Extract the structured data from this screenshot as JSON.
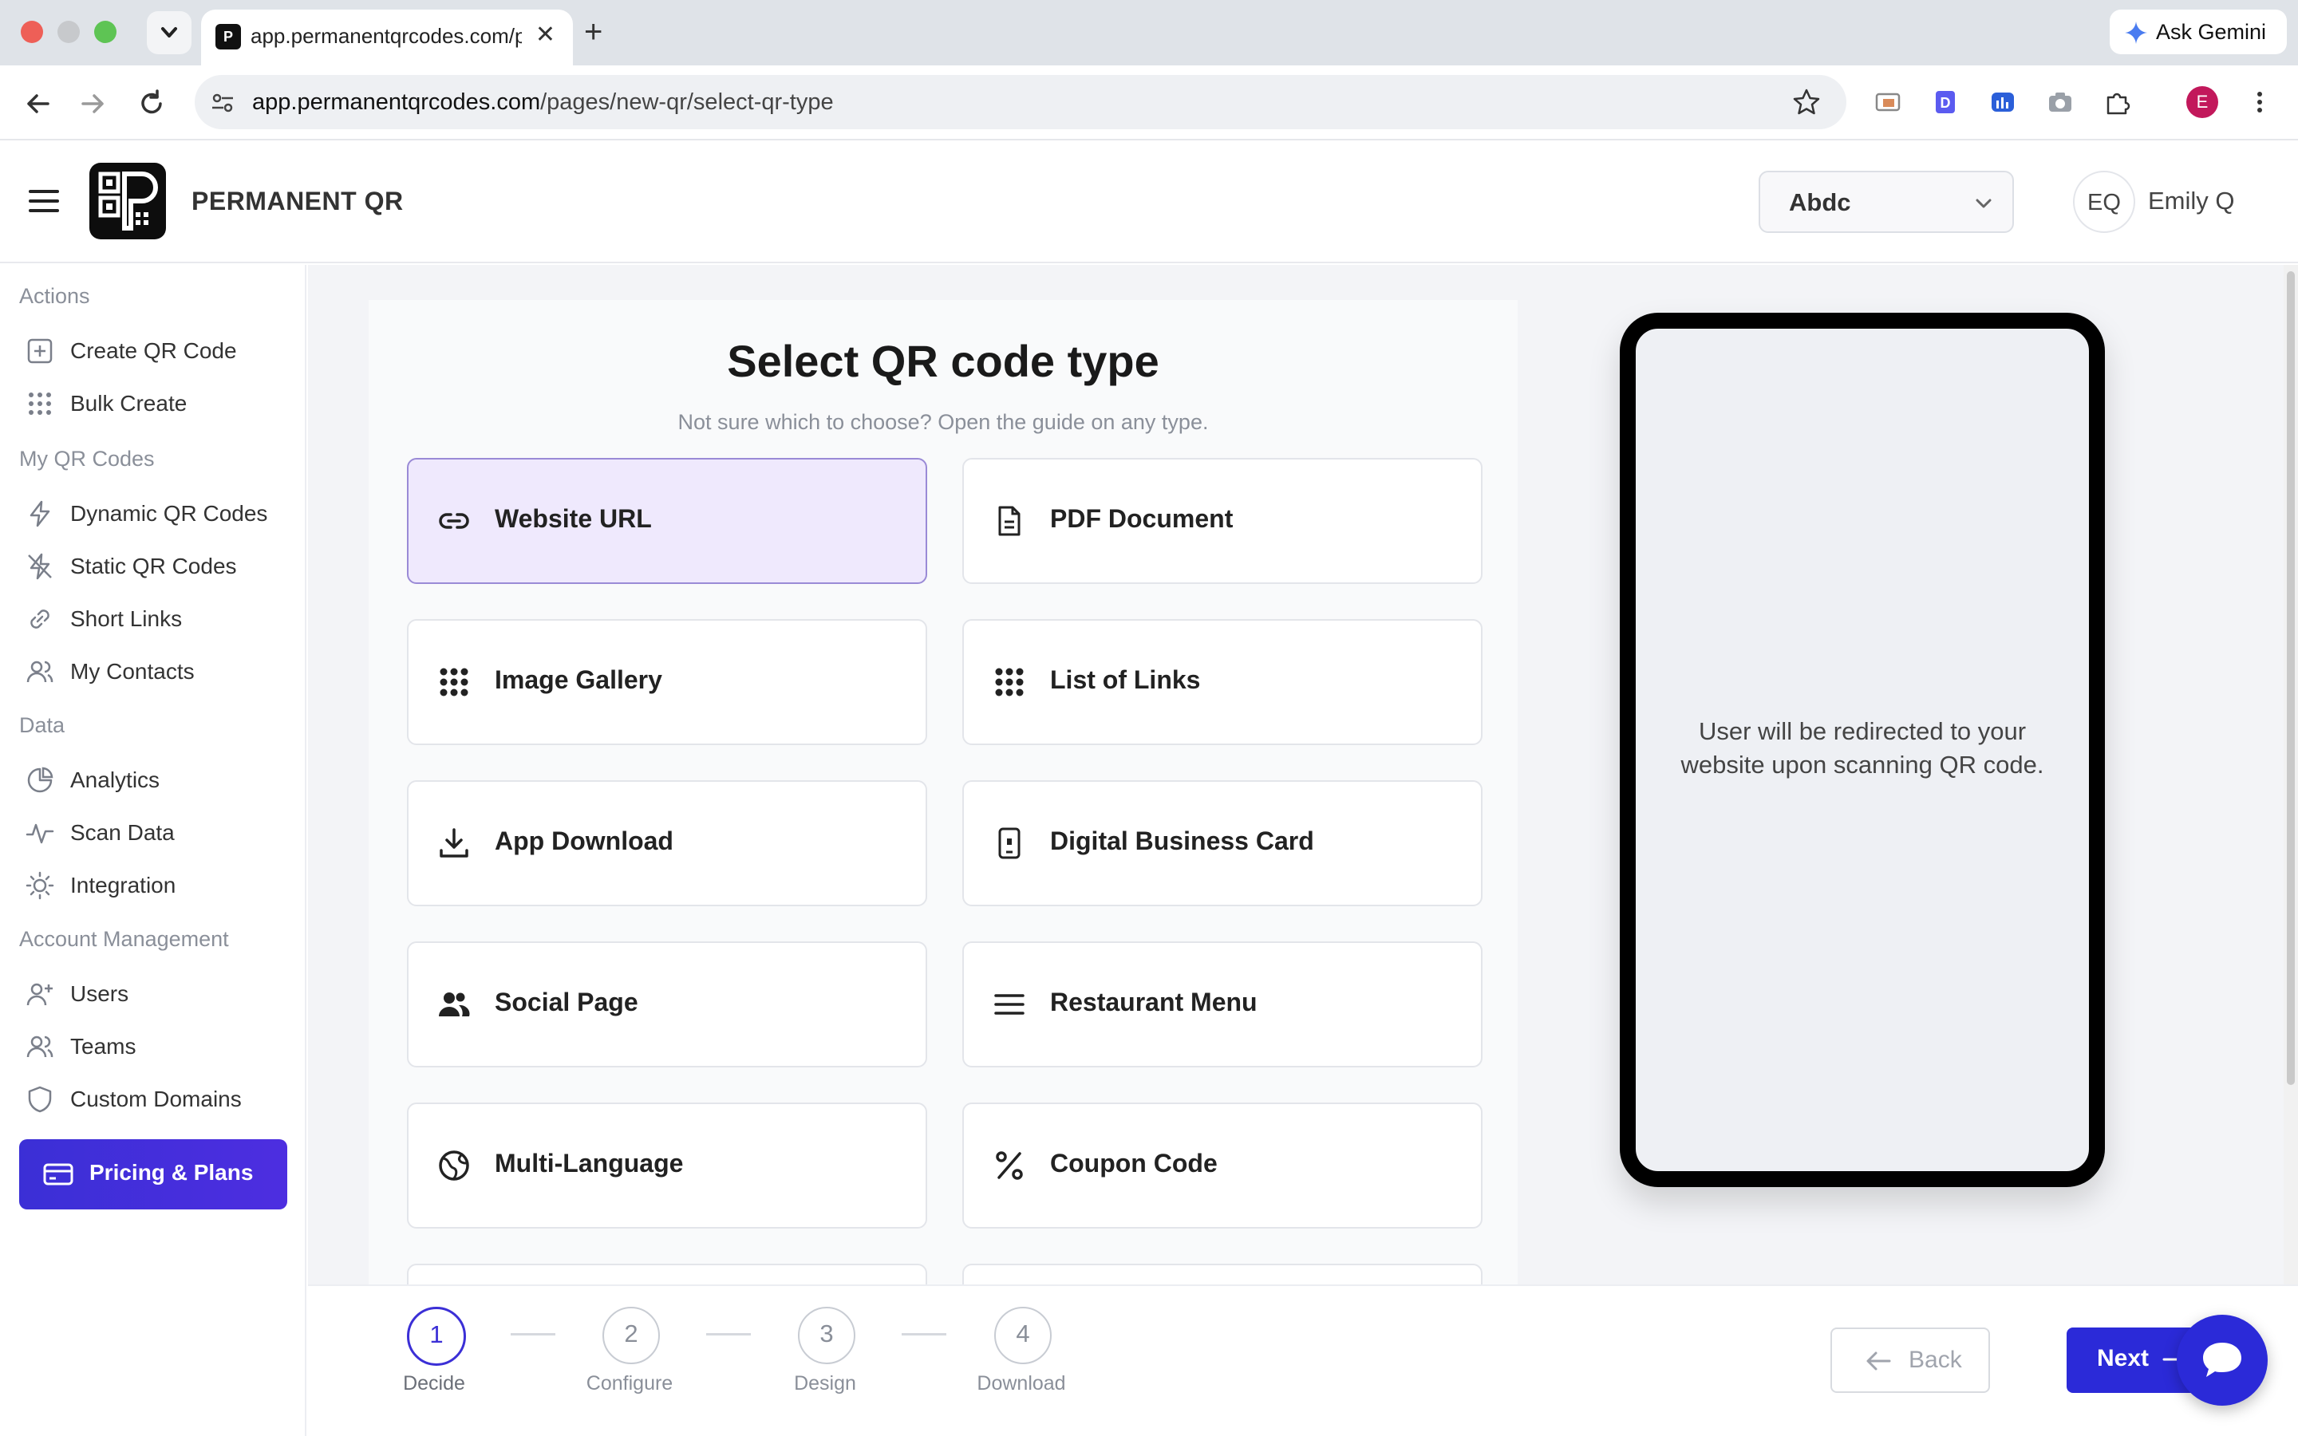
{
  "browser": {
    "tab_title": "app.permanentqrcodes.com/p",
    "url_domain": "app.permanentqrcodes.com",
    "url_path": "/pages/new-qr/select-qr-type",
    "gemini_label": "Ask Gemini",
    "profile_initial": "E"
  },
  "header": {
    "brand": "PERMANENT QR",
    "org_selected": "Abdc",
    "user_initials": "EQ",
    "user_name": "Emily Q"
  },
  "sidebar": {
    "sections": [
      {
        "title": "Actions",
        "items": [
          {
            "label": "Create QR Code",
            "icon": "plus-square-icon"
          },
          {
            "label": "Bulk Create",
            "icon": "grid-dots-icon"
          }
        ]
      },
      {
        "title": "My QR Codes",
        "items": [
          {
            "label": "Dynamic QR Codes",
            "icon": "lightning-icon"
          },
          {
            "label": "Static QR Codes",
            "icon": "lightning-off-icon"
          },
          {
            "label": "Short Links",
            "icon": "link-icon"
          },
          {
            "label": "My Contacts",
            "icon": "users-icon"
          }
        ]
      },
      {
        "title": "Data",
        "items": [
          {
            "label": "Analytics",
            "icon": "pie-chart-icon"
          },
          {
            "label": "Scan Data",
            "icon": "activity-icon"
          },
          {
            "label": "Integration",
            "icon": "bulb-icon"
          }
        ]
      },
      {
        "title": "Account Management",
        "items": [
          {
            "label": "Users",
            "icon": "user-plus-icon"
          },
          {
            "label": "Teams",
            "icon": "team-icon"
          },
          {
            "label": "Custom Domains",
            "icon": "shield-icon"
          }
        ]
      }
    ],
    "cta_label": "Pricing & Plans"
  },
  "main": {
    "title": "Select QR code type",
    "subtitle": "Not sure which to choose? Open the guide on any type.",
    "types": [
      {
        "label": "Website URL",
        "icon": "link-icon",
        "selected": true
      },
      {
        "label": "PDF Document",
        "icon": "document-icon",
        "selected": false
      },
      {
        "label": "Image Gallery",
        "icon": "grid-dots-icon",
        "selected": false
      },
      {
        "label": "List of Links",
        "icon": "grid-dots-icon",
        "selected": false
      },
      {
        "label": "App Download",
        "icon": "download-icon",
        "selected": false
      },
      {
        "label": "Digital Business Card",
        "icon": "mobile-icon",
        "selected": false
      },
      {
        "label": "Social Page",
        "icon": "people-icon",
        "selected": false
      },
      {
        "label": "Restaurant Menu",
        "icon": "menu-lines-icon",
        "selected": false
      },
      {
        "label": "Multi-Language",
        "icon": "globe-icon",
        "selected": false
      },
      {
        "label": "Coupon Code",
        "icon": "percent-icon",
        "selected": false
      }
    ],
    "preview_text": "User will be redirected to your website upon scanning QR code."
  },
  "stepper": {
    "steps": [
      {
        "number": "1",
        "label": "Decide",
        "active": true
      },
      {
        "number": "2",
        "label": "Configure",
        "active": false
      },
      {
        "number": "3",
        "label": "Design",
        "active": false
      },
      {
        "number": "4",
        "label": "Download",
        "active": false
      }
    ],
    "back_label": "Back",
    "next_label": "Next"
  },
  "colors": {
    "accent": "#2b2ad8",
    "selected_card_bg": "#efe9fd"
  }
}
